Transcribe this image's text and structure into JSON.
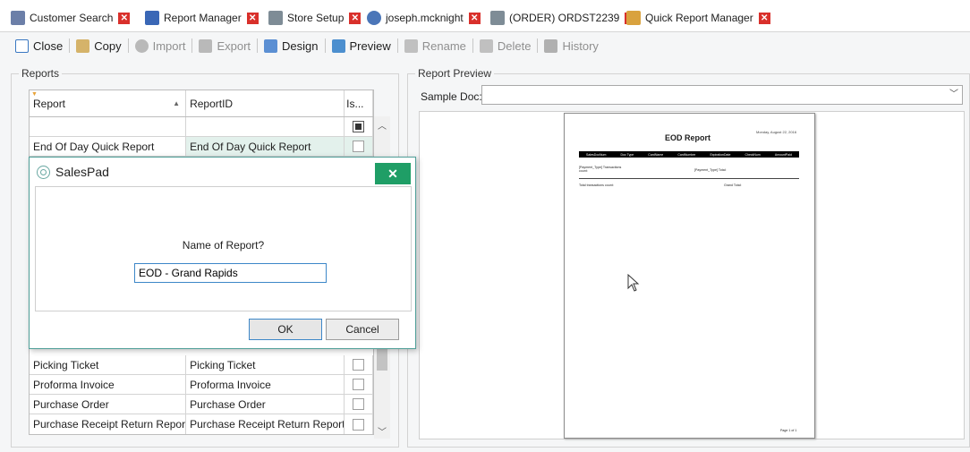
{
  "tabs": [
    {
      "label": "Customer Search",
      "icon": "customer-search-icon",
      "color": "#6c7fa8"
    },
    {
      "label": "Report Manager",
      "icon": "report-manager-icon",
      "color": "#3a67b6"
    },
    {
      "label": "Store Setup",
      "icon": "store-setup-icon",
      "color": "#7e8c96"
    },
    {
      "label": "joseph.mcknight",
      "icon": "user-icon",
      "color": "#4b76b8"
    },
    {
      "label": "(ORDER) ORDST2239",
      "icon": "order-icon",
      "color": "#7e8c96"
    },
    {
      "label": "Quick Report Manager",
      "icon": "quick-report-icon",
      "color": "#d9a23e"
    }
  ],
  "toolbar": {
    "close": "Close",
    "copy": "Copy",
    "import": "Import",
    "export": "Export",
    "design": "Design",
    "preview": "Preview",
    "rename": "Rename",
    "delete": "Delete",
    "history": "History"
  },
  "reports_group": {
    "label": "Reports"
  },
  "grid": {
    "headers": {
      "report": "Report",
      "report_id": "ReportID",
      "is": "Is..."
    },
    "rows_top": [
      {
        "report": "End Of Day Quick Report",
        "report_id": "End Of Day Quick Report"
      }
    ],
    "rows_bottom": [
      {
        "report": "Picking Ticket",
        "report_id": "Picking Ticket"
      },
      {
        "report": "Proforma Invoice",
        "report_id": "Proforma Invoice"
      },
      {
        "report": "Purchase Order",
        "report_id": "Purchase Order"
      },
      {
        "report": "Purchase Receipt Return Report",
        "report_id": "Purchase Receipt Return Report"
      }
    ]
  },
  "preview_group": {
    "label": "Report Preview",
    "sample_doc_label": "Sample Doc:"
  },
  "paper": {
    "title": "EOD Report",
    "date": "Monday, August 22, 2016",
    "columns": [
      "SalesDocNum",
      "Doc Type",
      "CardName",
      "CardNumber",
      "ExpirationDate",
      "CheckNum",
      "AmountPaid"
    ],
    "group_header": "[Payment_Type] Transactions count:",
    "group_total": "[Payment_Type] Total:",
    "total_count": "Total transactions count:",
    "grand_total": "Grand Total:",
    "footer": "Page 1 of 1"
  },
  "dialog": {
    "title": "SalesPad",
    "prompt": "Name of Report?",
    "input_value": "EOD - Grand Rapids",
    "ok": "OK",
    "cancel": "Cancel"
  },
  "colors": {
    "accent": "#1f9e66",
    "close_tab": "#d9302b",
    "row_highlight": "#e3f1ec"
  }
}
